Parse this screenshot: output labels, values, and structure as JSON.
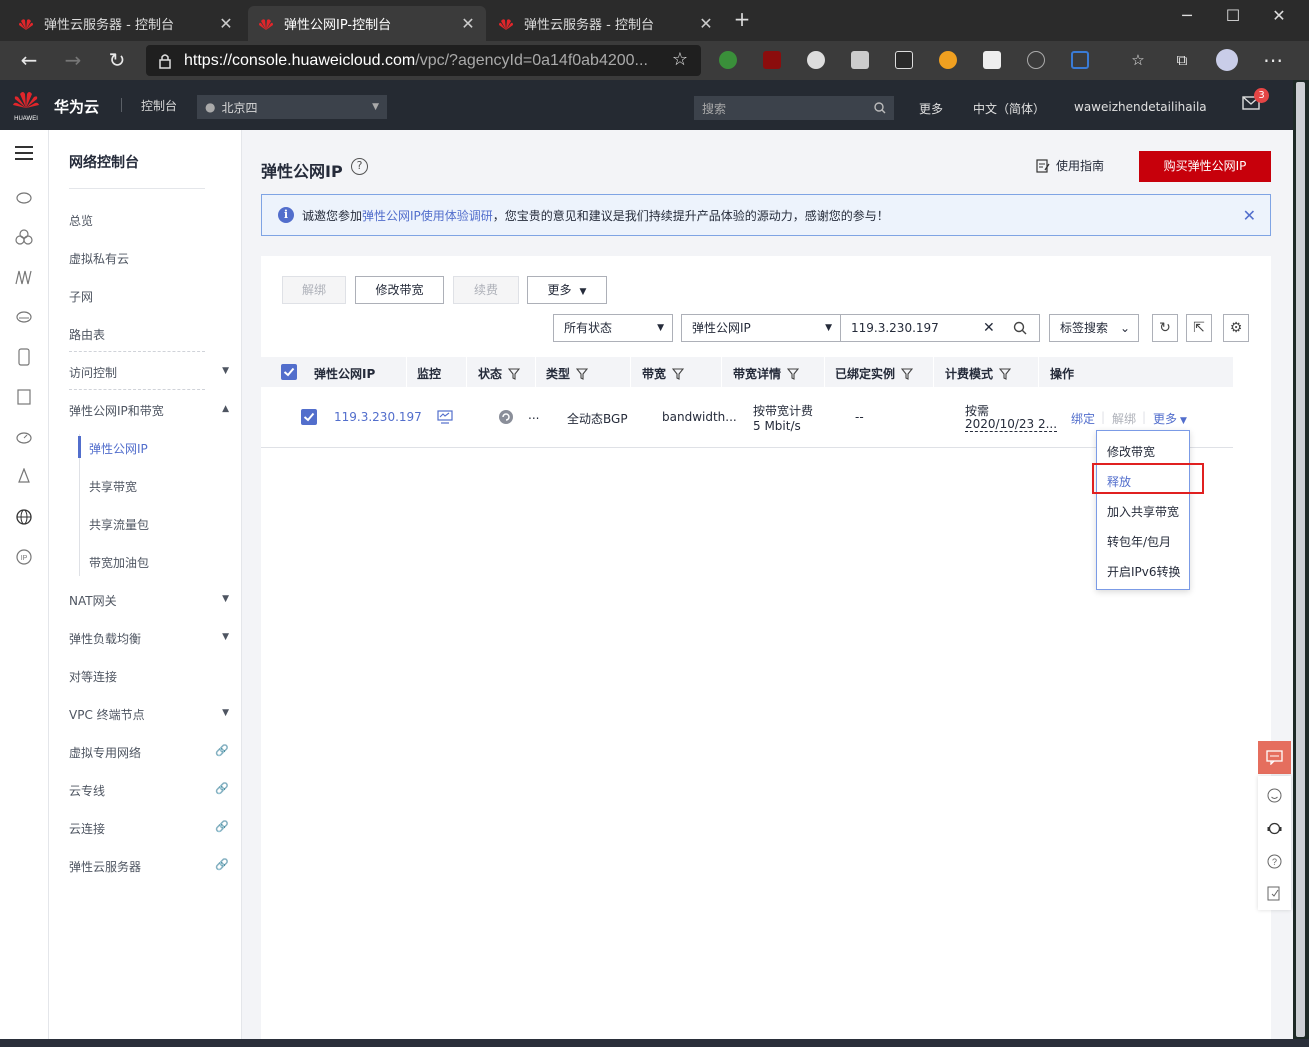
{
  "browser": {
    "tabs": [
      {
        "title": "弹性云服务器 - 控制台",
        "active": false
      },
      {
        "title": "弹性公网IP-控制台",
        "active": true
      },
      {
        "title": "弹性云服务器 - 控制台",
        "active": false
      }
    ],
    "url_main": "https://console.huaweicloud.com",
    "url_rest": "/vpc/?agencyId=0a14f0ab4200..."
  },
  "topbar": {
    "logo_text": "HUAWEI",
    "brand": "华为云",
    "console": "控制台",
    "region": "北京四",
    "search_placeholder": "搜索",
    "more": "更多",
    "language": "中文（简体）",
    "username": "waweizhendetailihaila",
    "mail_badge": "3"
  },
  "subnav": {
    "title": "网络控制台",
    "items": [
      {
        "label": "总览"
      },
      {
        "label": "虚拟私有云"
      },
      {
        "label": "子网"
      },
      {
        "label": "路由表"
      },
      {
        "label": "访问控制"
      },
      {
        "label": "弹性公网IP和带宽"
      },
      {
        "label": "弹性公网IP"
      },
      {
        "label": "共享带宽"
      },
      {
        "label": "共享流量包"
      },
      {
        "label": "带宽加油包"
      },
      {
        "label": "NAT网关"
      },
      {
        "label": "弹性负载均衡"
      },
      {
        "label": "对等连接"
      },
      {
        "label": "VPC 终端节点"
      },
      {
        "label": "虚拟专用网络"
      },
      {
        "label": "云专线"
      },
      {
        "label": "云连接"
      },
      {
        "label": "弹性云服务器"
      }
    ]
  },
  "page": {
    "title": "弹性公网IP",
    "guide": "使用指南",
    "buy_button": "购买弹性公网IP",
    "notice_prefix": "诚邀您参加",
    "notice_link": "弹性公网IP使用体验调研",
    "notice_suffix": "，您宝贵的意见和建议是我们持续提升产品体验的源动力，感谢您的参与！"
  },
  "toolbar": {
    "unbind": "解绑",
    "modify_bw": "修改带宽",
    "renew": "续费",
    "more": "更多",
    "status_filter": "所有状态",
    "attr_filter": "弹性公网IP",
    "search_value": "119.3.230.197",
    "tag_search": "标签搜索"
  },
  "table": {
    "headers": [
      "弹性公网IP",
      "监控",
      "状态",
      "类型",
      "带宽",
      "带宽详情",
      "已绑定实例",
      "计费模式",
      "操作"
    ],
    "rows": [
      {
        "ip": "119.3.230.197",
        "status_text": "...",
        "type": "全动态BGP",
        "bandwidth": "bandwidth...",
        "bw_detail_1": "按带宽计费",
        "bw_detail_2": "5 Mbit/s",
        "bound": "--",
        "billing_1": "按需",
        "billing_2": "2020/10/23 2...",
        "op_bind": "绑定",
        "op_unbind": "解绑",
        "op_more": "更多"
      }
    ]
  },
  "dropdown": {
    "items": [
      "修改带宽",
      "释放",
      "加入共享带宽",
      "转包年/包月",
      "开启IPv6转换"
    ],
    "selected": "释放"
  }
}
